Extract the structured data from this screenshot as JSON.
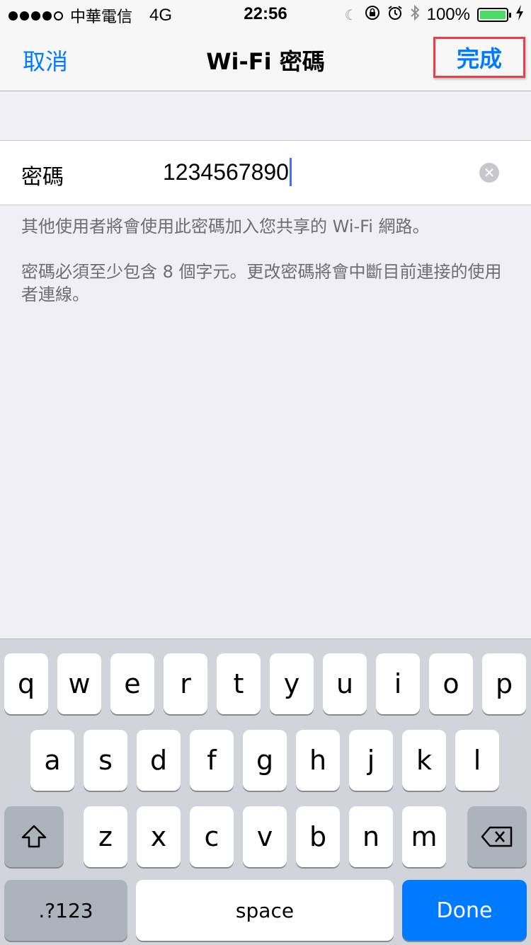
{
  "status_bar": {
    "carrier": "中華電信",
    "network": "4G",
    "time": "22:56",
    "battery": "100%",
    "icons": [
      "moon-icon",
      "rotation-lock-icon",
      "alarm-icon",
      "bluetooth-icon",
      "charging-icon"
    ]
  },
  "nav": {
    "cancel": "取消",
    "title": "Wi-Fi 密碼",
    "done": "完成"
  },
  "form": {
    "label": "密碼",
    "value": "1234567890",
    "clear": "✕"
  },
  "hints": {
    "line1": "其他使用者將會使用此密碼加入您共享的 Wi-Fi 網路。",
    "line2": "密碼必須至少包含 8 個字元。更改密碼將會中斷目前連接的使用者連線。"
  },
  "keyboard": {
    "row1": [
      "q",
      "w",
      "e",
      "r",
      "t",
      "y",
      "u",
      "i",
      "o",
      "p"
    ],
    "row2": [
      "a",
      "s",
      "d",
      "f",
      "g",
      "h",
      "j",
      "k",
      "l"
    ],
    "row3": [
      "z",
      "x",
      "c",
      "v",
      "b",
      "n",
      "m"
    ],
    "shift": "⇧",
    "delete": "⌫",
    "numbers": ".?123",
    "space": "space",
    "done": "Done"
  },
  "colors": {
    "accent": "#007aff",
    "highlight_border": "#e8404a",
    "battery": "#4cd964"
  }
}
